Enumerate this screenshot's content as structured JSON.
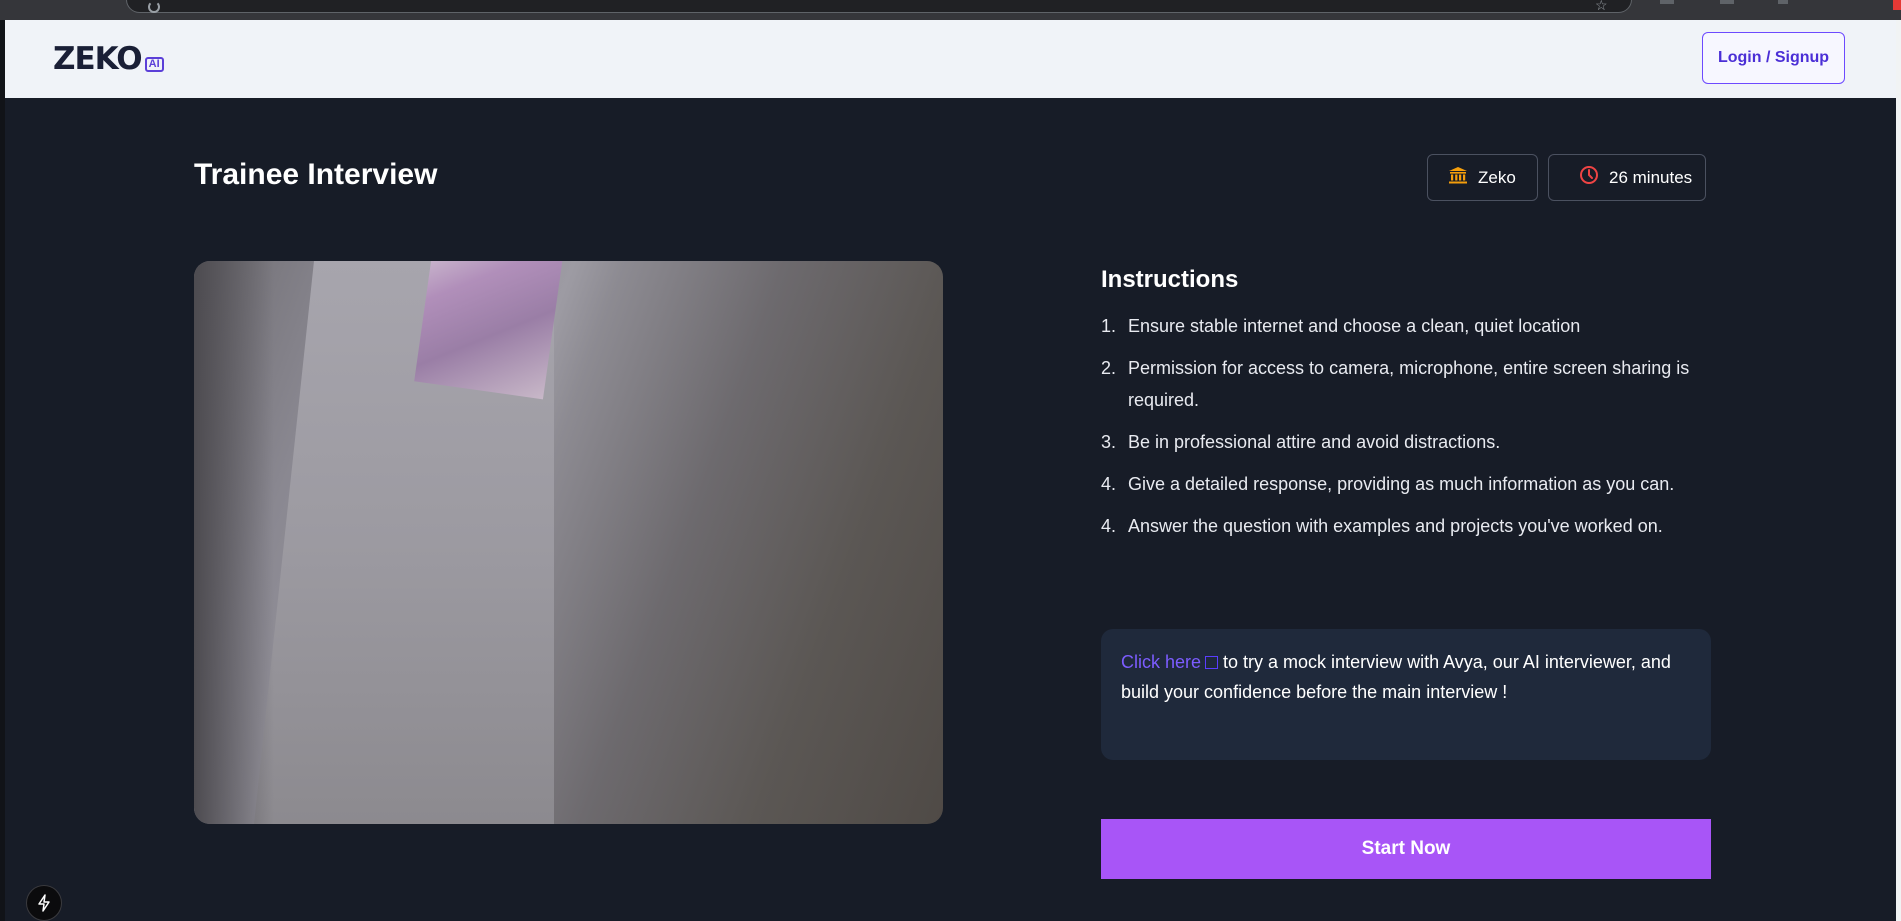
{
  "header": {
    "logo_text": "ZEKO",
    "logo_badge": "AI",
    "login_label": "Login / Signup"
  },
  "page": {
    "title": "Trainee Interview",
    "org_chip": "Zeko",
    "duration_chip": "26 minutes"
  },
  "instructions": {
    "title": "Instructions",
    "items": [
      {
        "num": "1.",
        "text": "Ensure stable internet and choose a clean, quiet location"
      },
      {
        "num": "2.",
        "text": "Permission for access to camera, microphone, entire screen sharing is required."
      },
      {
        "num": "3.",
        "text": "Be in professional attire and avoid distractions."
      },
      {
        "num": "4.",
        "text": "Give a detailed response, providing as much information as you can."
      },
      {
        "num": "4.",
        "text": "Answer the question with examples and projects you've worked on."
      }
    ]
  },
  "promo": {
    "link_text": "Click here",
    "body_text": " to try a mock interview with Avya, our AI interviewer, and build your confidence before the main interview !"
  },
  "start_label": "Start Now",
  "colors": {
    "accent": "#a855f7",
    "link": "#7c5cff",
    "background": "#171c27",
    "org_icon": "#f59e0b",
    "clock_icon": "#ef4444"
  },
  "icons": {
    "org": "bank-icon",
    "duration": "clock-icon",
    "external": "external-link-icon",
    "bottom_left": "lightning-icon"
  }
}
